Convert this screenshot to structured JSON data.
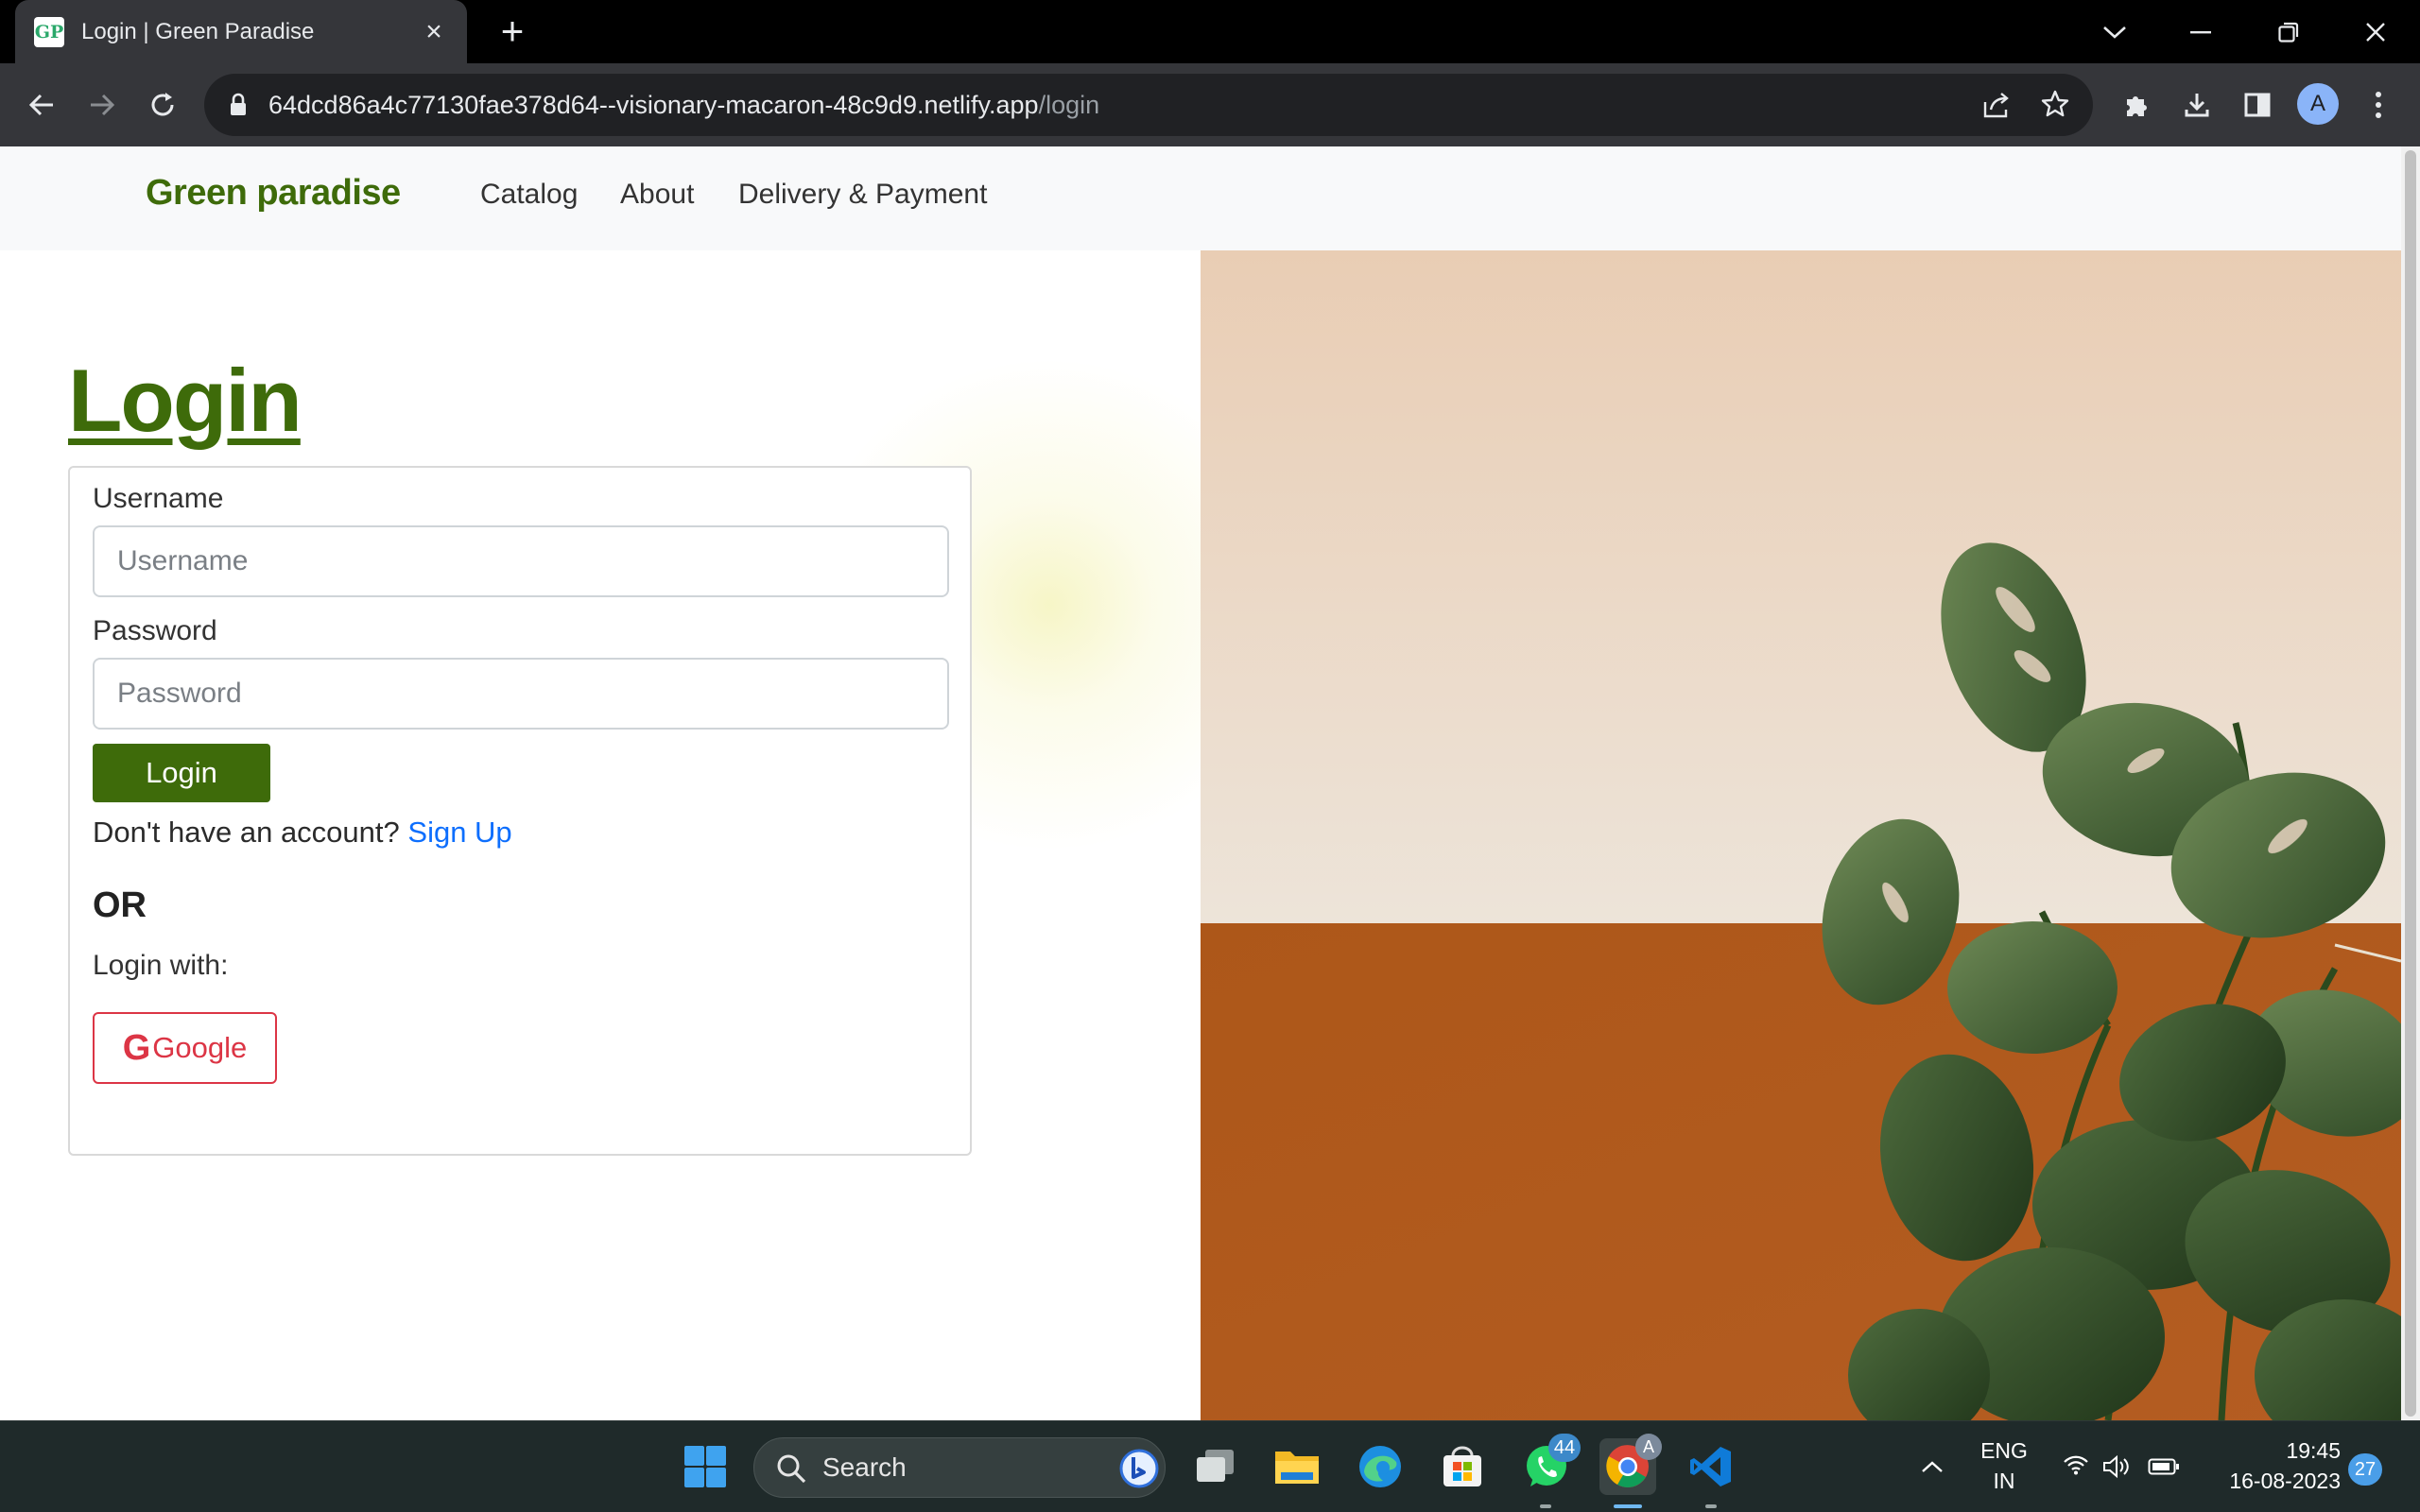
{
  "browser": {
    "tab_title": "Login | Green Paradise",
    "favicon_text": "GP",
    "url_host": "64dcd86a4c77130fae378d64--visionary-macaron-48c9d9.netlify.app",
    "url_path": "/login",
    "profile_initial": "A"
  },
  "nav": {
    "brand": "Green paradise",
    "links": [
      "Catalog",
      "About",
      "Delivery & Payment"
    ]
  },
  "login": {
    "title": "Login",
    "username_label": "Username",
    "username_placeholder": "Username",
    "username_value": "",
    "password_label": "Password",
    "password_placeholder": "Password",
    "password_value": "",
    "submit_label": "Login",
    "no_account_text": "Don't have an account?",
    "signup_link": "Sign Up",
    "or_text": "OR",
    "login_with_text": "Login with:",
    "google_label": "Google",
    "google_icon_letter": "G"
  },
  "hero_image": {
    "icon": "monstera-plant-photo"
  },
  "taskbar": {
    "search_placeholder": "Search",
    "whatsapp_badge": "44",
    "chrome_badge": "A",
    "lang_primary": "ENG",
    "lang_secondary": "IN",
    "time": "19:45",
    "date": "16-08-2023",
    "notification_count": "27"
  },
  "colors": {
    "brand_green": "#3e6b0a",
    "link_blue": "#0d6efd",
    "google_red": "#dc3545",
    "wall_beige": "#ecd9c6",
    "wall_rust": "#b0561c"
  }
}
